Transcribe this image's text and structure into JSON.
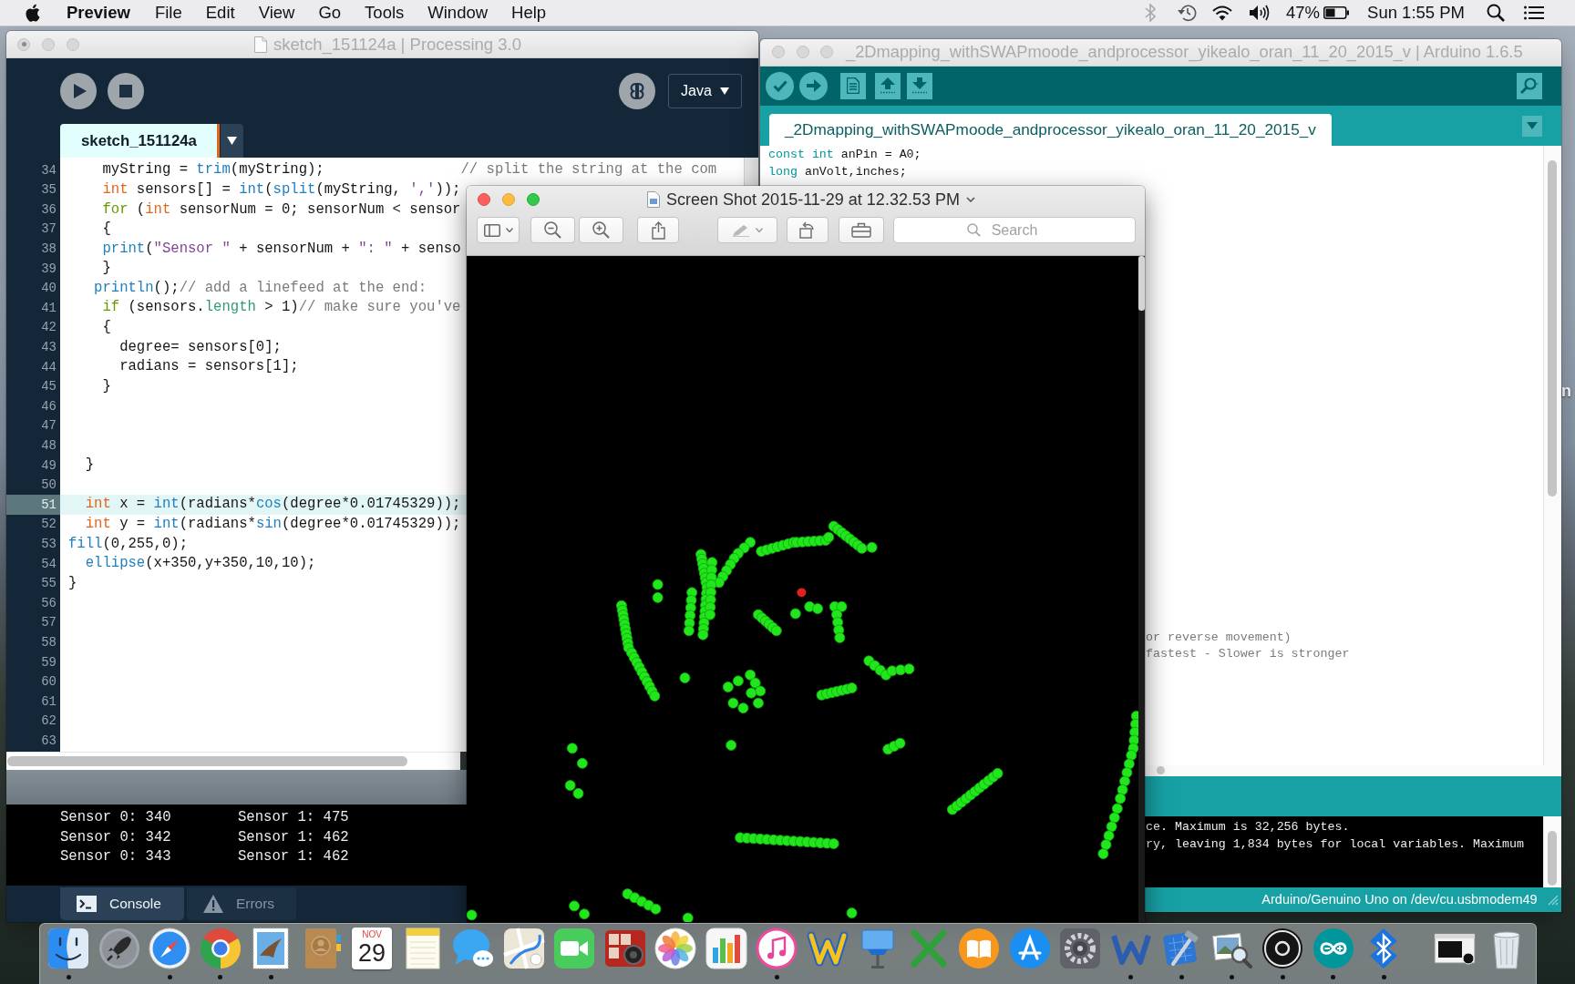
{
  "menu_bar": {
    "app": "Preview",
    "menus": [
      "File",
      "Edit",
      "View",
      "Go",
      "Tools",
      "Window",
      "Help"
    ],
    "battery": "47%",
    "clock": "Sun 1:55 PM"
  },
  "desktop": {
    "icon_label": "n"
  },
  "processing": {
    "title": "sketch_151124a | Processing 3.0",
    "focused": false,
    "unsaved": true,
    "mode": "Java",
    "tabs": [
      {
        "label": "sketch_151124a",
        "selected": true
      }
    ],
    "lines": [
      {
        "number": "34",
        "selected": false,
        "tokens": [
          {
            "kind": "plain",
            "text": "    myString = "
          },
          {
            "kind": "function",
            "text": "trim"
          },
          {
            "kind": "plain",
            "text": "(myString);                "
          },
          {
            "kind": "comment",
            "text": "// split the string at the com"
          }
        ]
      },
      {
        "number": "35",
        "selected": false,
        "tokens": [
          {
            "kind": "type",
            "text": "    int"
          },
          {
            "kind": "plain",
            "text": " sensors[] = "
          },
          {
            "kind": "function",
            "text": "int"
          },
          {
            "kind": "plain",
            "text": "("
          },
          {
            "kind": "function",
            "text": "split"
          },
          {
            "kind": "plain",
            "text": "(myString, "
          },
          {
            "kind": "string",
            "text": "','"
          },
          {
            "kind": "plain",
            "text": "));"
          }
        ]
      },
      {
        "number": "36",
        "selected": false,
        "tokens": [
          {
            "kind": "control",
            "text": "    for"
          },
          {
            "kind": "plain",
            "text": " ("
          },
          {
            "kind": "type",
            "text": "int"
          },
          {
            "kind": "plain",
            "text": " sensorNum = 0; sensorNum < sensor"
          }
        ]
      },
      {
        "number": "37",
        "selected": false,
        "tokens": [
          {
            "kind": "plain",
            "text": "    {"
          }
        ]
      },
      {
        "number": "38",
        "selected": false,
        "tokens": [
          {
            "kind": "function",
            "text": "    print"
          },
          {
            "kind": "plain",
            "text": "("
          },
          {
            "kind": "string",
            "text": "\"Sensor \""
          },
          {
            "kind": "plain",
            "text": " + sensorNum + "
          },
          {
            "kind": "string",
            "text": "\": \""
          },
          {
            "kind": "plain",
            "text": " + senso"
          }
        ]
      },
      {
        "number": "39",
        "selected": false,
        "tokens": [
          {
            "kind": "plain",
            "text": "    }"
          }
        ]
      },
      {
        "number": "40",
        "selected": false,
        "tokens": [
          {
            "kind": "function",
            "text": "   println"
          },
          {
            "kind": "plain",
            "text": "();"
          },
          {
            "kind": "comment",
            "text": "// add a linefeed at the end:"
          }
        ]
      },
      {
        "number": "41",
        "selected": false,
        "tokens": [
          {
            "kind": "control",
            "text": "    if"
          },
          {
            "kind": "plain",
            "text": " (sensors."
          },
          {
            "kind": "field",
            "text": "length"
          },
          {
            "kind": "plain",
            "text": " > 1)"
          },
          {
            "kind": "comment",
            "text": "// make sure you've"
          }
        ]
      },
      {
        "number": "42",
        "selected": false,
        "tokens": [
          {
            "kind": "plain",
            "text": "    {"
          }
        ]
      },
      {
        "number": "43",
        "selected": false,
        "tokens": [
          {
            "kind": "plain",
            "text": "      degree= sensors[0];"
          }
        ]
      },
      {
        "number": "44",
        "selected": false,
        "tokens": [
          {
            "kind": "plain",
            "text": "      radians = sensors[1];"
          }
        ]
      },
      {
        "number": "45",
        "selected": false,
        "tokens": [
          {
            "kind": "plain",
            "text": "    }"
          }
        ]
      },
      {
        "number": "46",
        "selected": false
      },
      {
        "number": "47",
        "selected": false
      },
      {
        "number": "48",
        "selected": false
      },
      {
        "number": "49",
        "selected": false,
        "tokens": [
          {
            "kind": "plain",
            "text": "  }"
          }
        ]
      },
      {
        "number": "50",
        "selected": false
      },
      {
        "number": "51",
        "selected": true,
        "tokens": [
          {
            "kind": "type",
            "text": "  int"
          },
          {
            "kind": "plain",
            "text": " x = "
          },
          {
            "kind": "function",
            "text": "int"
          },
          {
            "kind": "plain",
            "text": "(radians*"
          },
          {
            "kind": "function",
            "text": "cos"
          },
          {
            "kind": "plain",
            "text": "(degree*0.01745329));"
          }
        ]
      },
      {
        "number": "52",
        "selected": false,
        "tokens": [
          {
            "kind": "type",
            "text": "  int"
          },
          {
            "kind": "plain",
            "text": " y = "
          },
          {
            "kind": "function",
            "text": "int"
          },
          {
            "kind": "plain",
            "text": "(radians*"
          },
          {
            "kind": "function",
            "text": "sin"
          },
          {
            "kind": "plain",
            "text": "(degree*0.01745329));"
          }
        ]
      },
      {
        "number": "53",
        "selected": false,
        "tokens": [
          {
            "kind": "function",
            "text": "fill"
          },
          {
            "kind": "plain",
            "text": "(0,255,0);"
          }
        ]
      },
      {
        "number": "54",
        "selected": false,
        "tokens": [
          {
            "kind": "function",
            "text": "  ellipse"
          },
          {
            "kind": "plain",
            "text": "(x+350,y+350,10,10);"
          }
        ]
      },
      {
        "number": "55",
        "selected": false,
        "tokens": [
          {
            "kind": "plain",
            "text": "}"
          }
        ]
      },
      {
        "number": "56",
        "selected": false
      },
      {
        "number": "57",
        "selected": false
      },
      {
        "number": "58",
        "selected": false
      },
      {
        "number": "59",
        "selected": false
      },
      {
        "number": "60",
        "selected": false
      },
      {
        "number": "61",
        "selected": false
      },
      {
        "number": "62",
        "selected": false
      },
      {
        "number": "63",
        "selected": false
      }
    ],
    "console": [
      [
        "Sensor 0: 340",
        "Sensor 1: 475"
      ],
      [
        "Sensor 0: 342",
        "Sensor 1: 462"
      ],
      [
        "Sensor 0: 343",
        "Sensor 1: 462"
      ]
    ],
    "panels": [
      {
        "kind": "console",
        "label": "Console",
        "selected": true
      },
      {
        "kind": "errors",
        "label": "Errors",
        "selected": false
      }
    ]
  },
  "arduino": {
    "title": "_2Dmapping_withSWAPmoode_andprocessor_yikealo_oran_11_20_2015_v | Arduino 1.6.5",
    "focused": false,
    "tabs": [
      {
        "label": "_2Dmapping_withSWAPmoode_andprocessor_yikealo_oran_11_20_2015_v",
        "selected": true
      }
    ],
    "lines": [
      {
        "tokens": [
          {
            "kind": "keyword",
            "text": "const"
          },
          {
            "kind": "keyword",
            "text": " int"
          },
          {
            "kind": "plain",
            "text": " anPin = A0;"
          }
        ]
      },
      {
        "tokens": [
          {
            "kind": "keyword",
            "text": "long"
          },
          {
            "kind": "plain",
            "text": " anVolt,inches;"
          }
        ]
      }
    ],
    "fragments": [
      {
        "tokens": [
          {
            "kind": "comment",
            "text": "or reverse movement)"
          }
        ]
      },
      {
        "tokens": [
          {
            "kind": "comment",
            "text": "fastest - Slower is stronger"
          }
        ]
      }
    ],
    "console": [
      "ce. Maximum is 32,256 bytes.",
      "ry, leaving 1,834 bytes for local variables. Maximum"
    ],
    "board": "Arduino/Genuino Uno on /dev/cu.usbmodem49"
  },
  "preview": {
    "title": "Screen Shot 2015-11-29 at 12.32.53 PM",
    "focused": true,
    "search": {
      "placeholder": "Search"
    }
  },
  "dock": {
    "apps": [
      {
        "kind": "finder",
        "running": true
      },
      {
        "kind": "launchpad",
        "running": false
      },
      {
        "kind": "safari",
        "running": true
      },
      {
        "kind": "chrome",
        "running": true
      },
      {
        "kind": "mail",
        "running": true
      },
      {
        "kind": "contacts",
        "running": false
      },
      {
        "kind": "calendar",
        "running": false,
        "month": "NOV",
        "day": "29"
      },
      {
        "kind": "notes",
        "running": false
      },
      {
        "kind": "messages",
        "running": false
      },
      {
        "kind": "maps",
        "running": false
      },
      {
        "kind": "facetime",
        "running": false
      },
      {
        "kind": "photobooth",
        "running": false
      },
      {
        "kind": "photos",
        "running": false
      },
      {
        "kind": "numbers",
        "running": false
      },
      {
        "kind": "itunes",
        "running": true
      },
      {
        "kind": "zigzag",
        "running": false
      },
      {
        "kind": "keynote",
        "running": false
      },
      {
        "kind": "cross",
        "running": false
      },
      {
        "kind": "books",
        "running": false
      },
      {
        "kind": "appstore",
        "running": false
      },
      {
        "kind": "prefs",
        "running": false
      },
      {
        "kind": "word",
        "running": true
      },
      {
        "kind": "xcode",
        "running": true
      },
      {
        "kind": "preview",
        "running": true
      },
      {
        "kind": "ring",
        "running": true
      },
      {
        "kind": "arduino",
        "running": true
      },
      {
        "kind": "bluetooth",
        "running": true
      }
    ],
    "extras": [
      {
        "kind": "window",
        "running": false
      },
      {
        "kind": "trash",
        "running": false
      }
    ]
  }
}
